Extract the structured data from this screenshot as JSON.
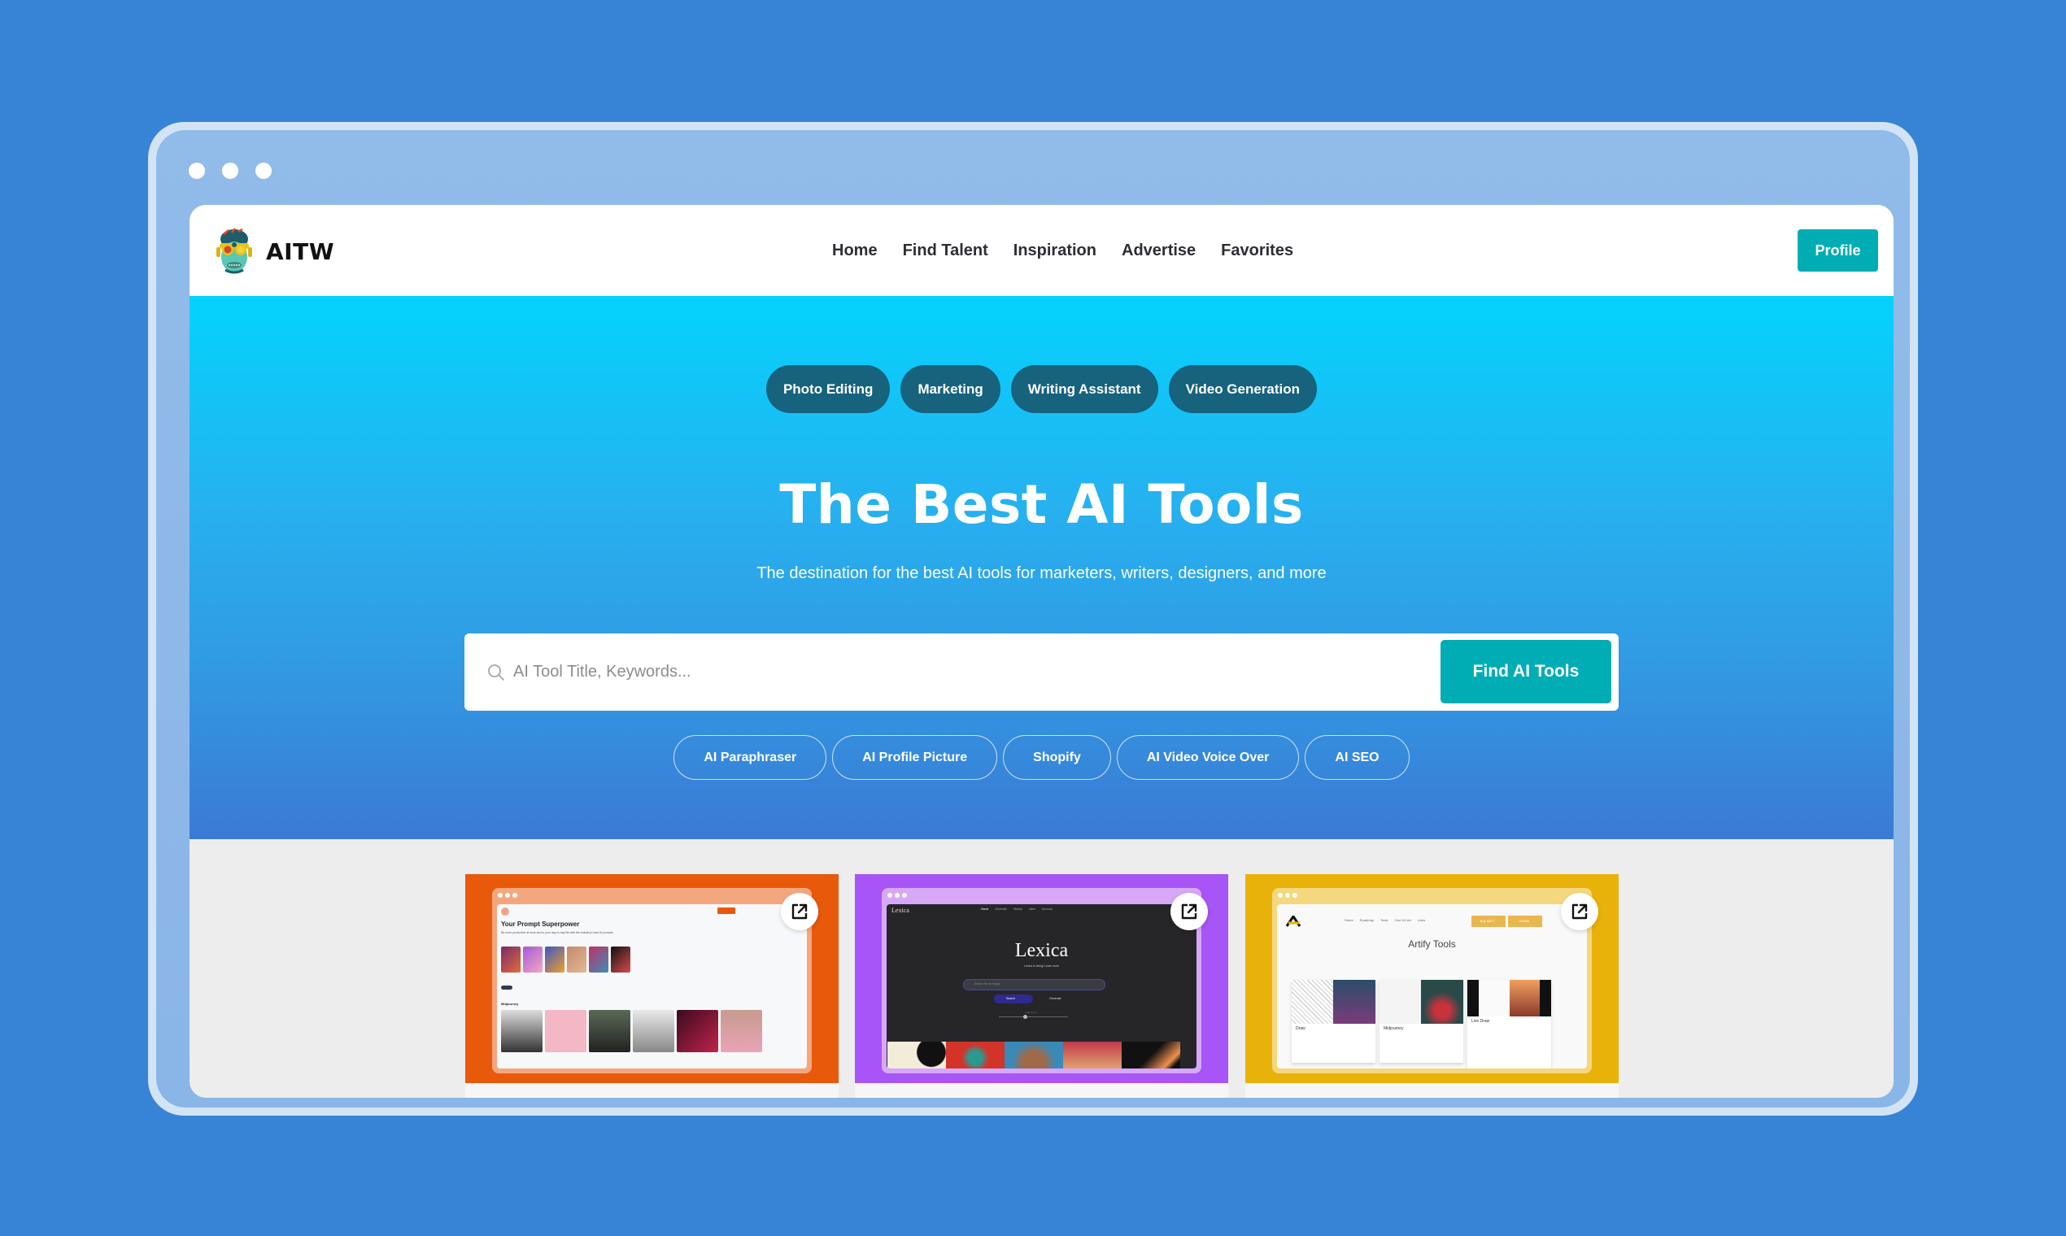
{
  "window": {
    "controls": [
      "dot",
      "dot",
      "dot"
    ]
  },
  "navbar": {
    "brand": "AITW",
    "logo_icon": "cyborg-monkey-logo",
    "links": [
      {
        "label": "Home"
      },
      {
        "label": "Find Talent"
      },
      {
        "label": "Inspiration"
      },
      {
        "label": "Advertise"
      },
      {
        "label": "Favorites"
      }
    ],
    "profile_label": "Profile"
  },
  "hero": {
    "categories": [
      {
        "label": "Photo Editing"
      },
      {
        "label": "Marketing"
      },
      {
        "label": "Writing Assistant"
      },
      {
        "label": "Video Generation"
      }
    ],
    "title": "The Best AI Tools",
    "subtitle": "The destination for the best AI tools for marketers, writers, designers, and more",
    "search": {
      "placeholder": "AI Tool Title, Keywords...",
      "value": "",
      "icon": "search-icon",
      "button_label": "Find AI Tools"
    },
    "tags": [
      {
        "label": "AI Paraphraser"
      },
      {
        "label": "AI Profile Picture"
      },
      {
        "label": "Shopify"
      },
      {
        "label": "AI Video Voice Over"
      },
      {
        "label": "AI SEO"
      }
    ]
  },
  "tool_cards": [
    {
      "name": "prompt-marketplace",
      "bg_color": "#e8590c",
      "frame_color": "#f4a77f",
      "preview_heading": "Your Prompt Superpower",
      "preview_subheading": "Be more productive at work and in your day-to-day life with the industry's best AI prompts",
      "preview_section": "Midjourney",
      "preview_link": "See more",
      "external_icon": "external-link-icon"
    },
    {
      "name": "lexica",
      "bg_color": "#a855f7",
      "frame_color": "#d7a8f7",
      "preview_brand": "Lexica",
      "preview_nav": [
        "Home",
        "Generate",
        "History",
        "Likes",
        "Account"
      ],
      "preview_heading": "Lexica",
      "preview_subheading": "Lexica is hiring! Learn more",
      "preview_search_placeholder": "Search for an image",
      "preview_buttons": [
        "Search",
        "Generate"
      ],
      "preview_slider_label": "Columns: 5",
      "external_icon": "external-link-icon"
    },
    {
      "name": "artify-tools",
      "bg_color": "#e9b20b",
      "frame_color": "#f4d77e",
      "preview_nav": [
        "Home",
        "Roadmap",
        "Tools",
        "Your MJ Art",
        "Links"
      ],
      "preview_buttons": [
        "Buy $ATY",
        "DRAW"
      ],
      "preview_heading": "Artify Tools",
      "preview_items": [
        "Draw",
        "Midjourney",
        "Live Draw"
      ],
      "external_icon": "external-link-icon"
    }
  ]
}
